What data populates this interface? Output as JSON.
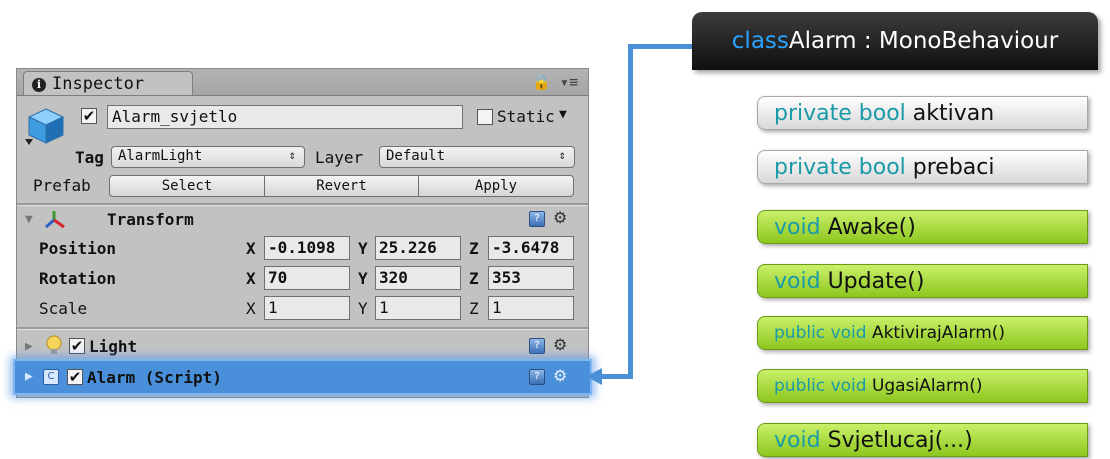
{
  "inspector": {
    "tab_label": "Inspector",
    "tab_tools": "🔒 ▾≡",
    "object_name": "Alarm_svjetlo",
    "static_label": "Static",
    "tag_label": "Tag",
    "tag_value": "AlarmLight",
    "layer_label": "Layer",
    "layer_value": "Default",
    "prefab_label": "Prefab",
    "prefab_buttons": [
      "Select",
      "Revert",
      "Apply"
    ],
    "transform": {
      "title": "Transform",
      "rows": [
        {
          "label": "Position",
          "x": "-0.1098",
          "y": "25.226",
          "z": "-3.6478"
        },
        {
          "label": "Rotation",
          "x": "70",
          "y": "320",
          "z": "353"
        },
        {
          "label": "Scale",
          "x": "1",
          "y": "1",
          "z": "1"
        }
      ]
    },
    "components": [
      {
        "title": "Light"
      },
      {
        "title": "Alarm (Script)"
      }
    ],
    "axis_labels": [
      "X",
      "Y",
      "Z"
    ]
  },
  "diagram": {
    "class_header": {
      "prefix": "class ",
      "name": "Alarm : MonoBehaviour"
    },
    "members": [
      {
        "kw1": "private ",
        "kw2": "bool ",
        "name": "aktivan",
        "style": "private"
      },
      {
        "kw1": "private ",
        "kw2": "bool ",
        "name": "prebaci",
        "style": "private"
      },
      {
        "kw1": "",
        "kw2": "void ",
        "name": "Awake()",
        "style": "public"
      },
      {
        "kw1": "",
        "kw2": "void ",
        "name": "Update()",
        "style": "public"
      },
      {
        "kw1": "public ",
        "kw2": "void ",
        "name": "AktivirajAlarm()",
        "style": "public"
      },
      {
        "kw1": "public ",
        "kw2": "void ",
        "name": "UgasiAlarm()",
        "style": "public"
      },
      {
        "kw1": "",
        "kw2": "void ",
        "name": "Svjetlucaj(...)",
        "style": "public"
      }
    ],
    "colors": {
      "keyword": "#1b9aa8",
      "header_keyword": "#2aa3ff",
      "connector": "#4a90d6",
      "highlight": "#4a8fd9"
    }
  }
}
